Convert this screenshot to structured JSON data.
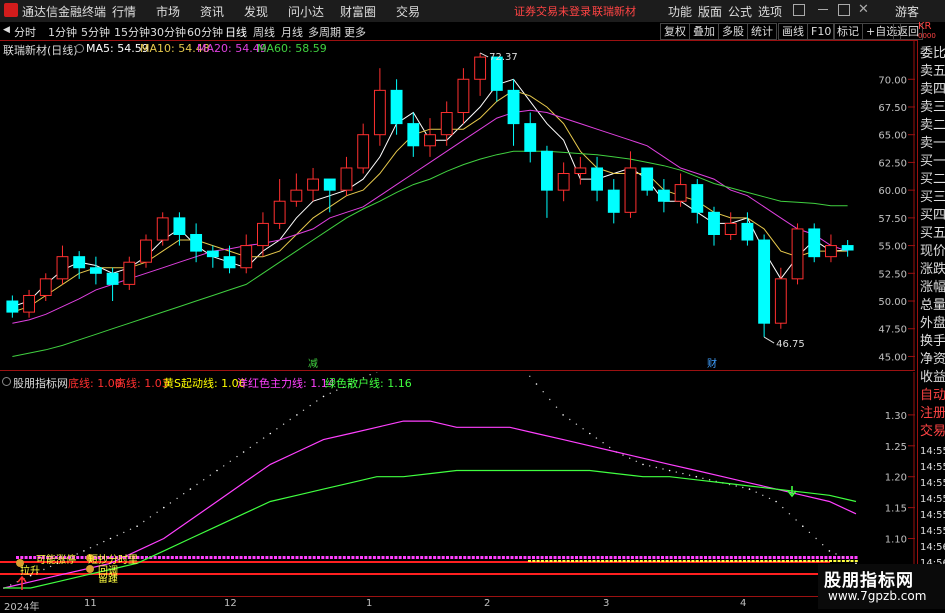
{
  "titlebar": {
    "app_name": "通达信金融终端",
    "menus": [
      "行情",
      "市场",
      "资讯",
      "发现",
      "问小达",
      "财富圈",
      "交易"
    ],
    "login_notice": "证券交易未登录",
    "stock_name": "联瑞新材",
    "tools": [
      "功能",
      "版面",
      "公式",
      "选项"
    ],
    "guest": "游客"
  },
  "periods": [
    "分时",
    "1分钟",
    "5分钟",
    "15分钟",
    "30分钟",
    "60分钟",
    "日线",
    "周线",
    "月线",
    "多周期",
    "更多"
  ],
  "active_period": "日线",
  "right_tools": [
    "复权",
    "叠加",
    "多股",
    "统计",
    "画线",
    "F10",
    "标记",
    "+自选",
    "返回"
  ],
  "main": {
    "title": "联瑞新材(日线)",
    "ma": [
      {
        "label": "MA5: 54.59",
        "color": "#ffffff"
      },
      {
        "label": "MA10: 54.48",
        "color": "#e6c84c"
      },
      {
        "label": "MA20: 54.49",
        "color": "#e040e0"
      },
      {
        "label": "MA60: 58.59",
        "color": "#40d040"
      }
    ],
    "high_label": "72.37",
    "low_label": "46.75",
    "marker_left": "减",
    "marker_right": "财"
  },
  "indicator": {
    "title": "股朋指标网",
    "legend": [
      {
        "label": "底线: 1.00",
        "color": "#ff3030"
      },
      {
        "label": "高线: 1.03",
        "color": "#ff3030"
      },
      {
        "label": "黄S起动线: 1.06",
        "color": "#ffff00"
      },
      {
        "label": "洋红色主力线: 1.14",
        "color": "#ff40ff"
      },
      {
        "label": "绿色散户线: 1.16",
        "color": "#40ff40"
      }
    ],
    "ann1": "可能涨停",
    "ann2": "短抄分时里",
    "ann3": "拉升",
    "ann4": "回调",
    "ann5": "留踵"
  },
  "chart_data": [
    {
      "type": "candlestick",
      "title": "联瑞新材(日线)",
      "ylim": [
        44.5,
        73
      ],
      "y_ticks": [
        45.0,
        47.5,
        50.0,
        52.5,
        55.0,
        57.5,
        60.0,
        62.5,
        65.0,
        67.5,
        70.0
      ],
      "y_tick_labels": [
        "45.00",
        "47.50",
        "50.00",
        "52.50",
        "55.00",
        "57.50",
        "60.00",
        "62.50",
        "65.00",
        "67.50",
        "70.00"
      ],
      "high": 72.37,
      "low": 46.75,
      "series": [
        {
          "name": "MA5",
          "values": [
            49.5,
            50,
            51.5,
            52.8,
            53.5,
            53.2,
            52.5,
            53,
            54,
            55.5,
            56.5,
            55,
            54,
            53.5,
            53,
            54.5,
            55.5,
            57.5,
            59,
            59.5,
            60,
            61,
            63,
            66,
            67,
            64.5,
            64.5,
            66,
            67.5,
            69.5,
            70,
            68,
            66,
            64.5,
            61,
            61,
            61.5,
            62,
            61,
            59,
            59,
            58,
            57,
            57,
            57.5,
            54.5,
            52,
            54,
            55.5,
            54.5,
            54.6
          ]
        },
        {
          "name": "MA10",
          "values": [
            49,
            49.5,
            50.5,
            51.5,
            52.5,
            53,
            53,
            53,
            53.5,
            54.5,
            55.5,
            55.5,
            55,
            54.5,
            54,
            54,
            54.5,
            56,
            57.5,
            58.5,
            59.5,
            60,
            61.5,
            63.5,
            65,
            65.5,
            65.5,
            65.5,
            66.5,
            68,
            69,
            68.5,
            67.5,
            66,
            63.5,
            62,
            61.5,
            61.5,
            61.5,
            60,
            59.5,
            59,
            58,
            57.5,
            57.5,
            56.5,
            54.5,
            54,
            54.5,
            54.5,
            54.5
          ]
        },
        {
          "name": "MA20",
          "values": [
            48,
            48.3,
            48.8,
            49.5,
            50.2,
            51,
            51.5,
            52,
            52.5,
            53,
            53.5,
            54,
            54.5,
            54.7,
            55,
            55.2,
            55.5,
            56,
            56.5,
            57.5,
            58,
            58.5,
            59.5,
            60.5,
            61.5,
            62.5,
            63.5,
            64.5,
            65.5,
            66.5,
            67,
            67.2,
            67,
            66.5,
            66,
            65.5,
            65,
            64.5,
            64,
            63,
            62,
            61.5,
            61,
            60,
            59.5,
            58.5,
            57.5,
            56.5,
            56,
            55,
            54.5
          ]
        },
        {
          "name": "MA60",
          "values": [
            45,
            45.3,
            45.6,
            46,
            46.5,
            47,
            47.5,
            48,
            48.5,
            49,
            49.5,
            50,
            50.5,
            51,
            51.5,
            52.5,
            53.5,
            54.5,
            55.5,
            56.5,
            57.5,
            58.3,
            59,
            59.8,
            60.5,
            61,
            61.7,
            62.3,
            62.8,
            63.2,
            63.5,
            63.5,
            63.5,
            63.4,
            63.3,
            63.2,
            63,
            62.8,
            62.5,
            62.2,
            61.8,
            61.2,
            60.6,
            60.2,
            59.8,
            59.4,
            59,
            58.9,
            58.8,
            58.6,
            58.59
          ]
        }
      ],
      "candles": [
        [
          50,
          49,
          50.5,
          48.5
        ],
        [
          49,
          50.5,
          51,
          48.5
        ],
        [
          50.5,
          52,
          52.5,
          50
        ],
        [
          52,
          54,
          55,
          51.5
        ],
        [
          54,
          53,
          54.5,
          52
        ],
        [
          53,
          52.5,
          54,
          51.5
        ],
        [
          52.5,
          51.5,
          53,
          50
        ],
        [
          51.5,
          53.5,
          54,
          51
        ],
        [
          53.5,
          55.5,
          56,
          53
        ],
        [
          55.5,
          57.5,
          58,
          55
        ],
        [
          57.5,
          56,
          58,
          55
        ],
        [
          56,
          54.5,
          57,
          53.5
        ],
        [
          54.5,
          54,
          55,
          53
        ],
        [
          54,
          53,
          55,
          52.5
        ],
        [
          53,
          55,
          56,
          52.5
        ],
        [
          55,
          57,
          58,
          54
        ],
        [
          57,
          59,
          61,
          56.5
        ],
        [
          59,
          60,
          61.5,
          58.5
        ],
        [
          60,
          61,
          62,
          59
        ],
        [
          61,
          60,
          61,
          58
        ],
        [
          60,
          62,
          63,
          59.5
        ],
        [
          62,
          65,
          66,
          61.5
        ],
        [
          65,
          69,
          71,
          64
        ],
        [
          69,
          66,
          70,
          65
        ],
        [
          66,
          64,
          67,
          63
        ],
        [
          64,
          65,
          66.5,
          63
        ],
        [
          65,
          67,
          68,
          64
        ],
        [
          67,
          70,
          71,
          66
        ],
        [
          70,
          72,
          72.37,
          68.5
        ],
        [
          72,
          69,
          72,
          68
        ],
        [
          69,
          66,
          70,
          64
        ],
        [
          66,
          63.5,
          67,
          62.5
        ],
        [
          63.5,
          60,
          64,
          57.5
        ],
        [
          60,
          61.5,
          62.5,
          59
        ],
        [
          61.5,
          62,
          63,
          60.5
        ],
        [
          62,
          60,
          63,
          59
        ],
        [
          60,
          58,
          61,
          57
        ],
        [
          58,
          62,
          63.5,
          57.5
        ],
        [
          62,
          60,
          62,
          59.5
        ],
        [
          60,
          59,
          61,
          58
        ],
        [
          59,
          60.5,
          61.5,
          58.5
        ],
        [
          60.5,
          58,
          61,
          57
        ],
        [
          58,
          56,
          58.5,
          55
        ],
        [
          56,
          57,
          58,
          55.5
        ],
        [
          57,
          55.5,
          58,
          55
        ],
        [
          55.5,
          48,
          56,
          46.75
        ],
        [
          48,
          52,
          53,
          47.5
        ],
        [
          52,
          56.5,
          57,
          51.5
        ],
        [
          56.5,
          54,
          57,
          53.5
        ],
        [
          54,
          55,
          56,
          53.5
        ],
        [
          55,
          54.6,
          55.5,
          54
        ]
      ]
    },
    {
      "type": "line",
      "title": "股朋指标网",
      "ylim": [
        1.02,
        1.35
      ],
      "y_ticks": [
        1.05,
        1.1,
        1.15,
        1.2,
        1.25,
        1.3
      ],
      "y_tick_labels": [
        "1.05",
        "1.10",
        "1.15",
        "1.20",
        "1.25",
        "1.30"
      ],
      "series": [
        {
          "name": "底线",
          "values": [
            1.0,
            1.0
          ]
        },
        {
          "name": "高线",
          "values": [
            1.03,
            1.03
          ]
        },
        {
          "name": "黄S起动线",
          "values": [
            1.02,
            1.04,
            1.06,
            1.08,
            1.1,
            1.12,
            1.15,
            1.18,
            1.21,
            1.24,
            1.27,
            1.3,
            1.33,
            1.35,
            1.37,
            1.38,
            1.4,
            1.41,
            1.42,
            1.4,
            1.35,
            1.3,
            1.27,
            1.24,
            1.22,
            1.21,
            1.2,
            1.19,
            1.18,
            1.16,
            1.12,
            1.08,
            1.06
          ]
        },
        {
          "name": "洋红色主力线",
          "values": [
            1.02,
            1.03,
            1.04,
            1.05,
            1.06,
            1.08,
            1.1,
            1.13,
            1.16,
            1.19,
            1.22,
            1.24,
            1.26,
            1.27,
            1.28,
            1.29,
            1.29,
            1.28,
            1.28,
            1.28,
            1.27,
            1.26,
            1.25,
            1.24,
            1.23,
            1.22,
            1.21,
            1.2,
            1.19,
            1.18,
            1.17,
            1.16,
            1.14
          ]
        },
        {
          "name": "绿色散户线",
          "values": [
            1.02,
            1.02,
            1.03,
            1.04,
            1.05,
            1.06,
            1.08,
            1.1,
            1.12,
            1.14,
            1.16,
            1.17,
            1.18,
            1.19,
            1.2,
            1.2,
            1.205,
            1.21,
            1.21,
            1.21,
            1.21,
            1.21,
            1.21,
            1.205,
            1.2,
            1.2,
            1.195,
            1.19,
            1.185,
            1.18,
            1.175,
            1.17,
            1.16
          ]
        }
      ]
    }
  ],
  "date_labels": [
    "2024年",
    "11",
    "12",
    "1",
    "2",
    "3",
    "4"
  ],
  "side_panel": [
    "委比",
    "卖五",
    "卖四",
    "卖三",
    "卖二",
    "卖一",
    "买一",
    "买二",
    "买三",
    "买四",
    "买五",
    "现价",
    "涨跌",
    "涨幅",
    "总量",
    "外盘",
    "换手",
    "净资",
    "收益",
    "自动",
    "注册",
    "交易"
  ],
  "side_times": [
    "14:55",
    "14:55",
    "14:55",
    "14:55",
    "14:55",
    "14:55",
    "14:56",
    "14:56"
  ],
  "watermark": {
    "line1": "股朋指标网",
    "line2": "www.7gpzb.com"
  },
  "colors": {
    "up": "#ff3030",
    "down": "#00ffff",
    "grid_red": "#9b1111"
  }
}
